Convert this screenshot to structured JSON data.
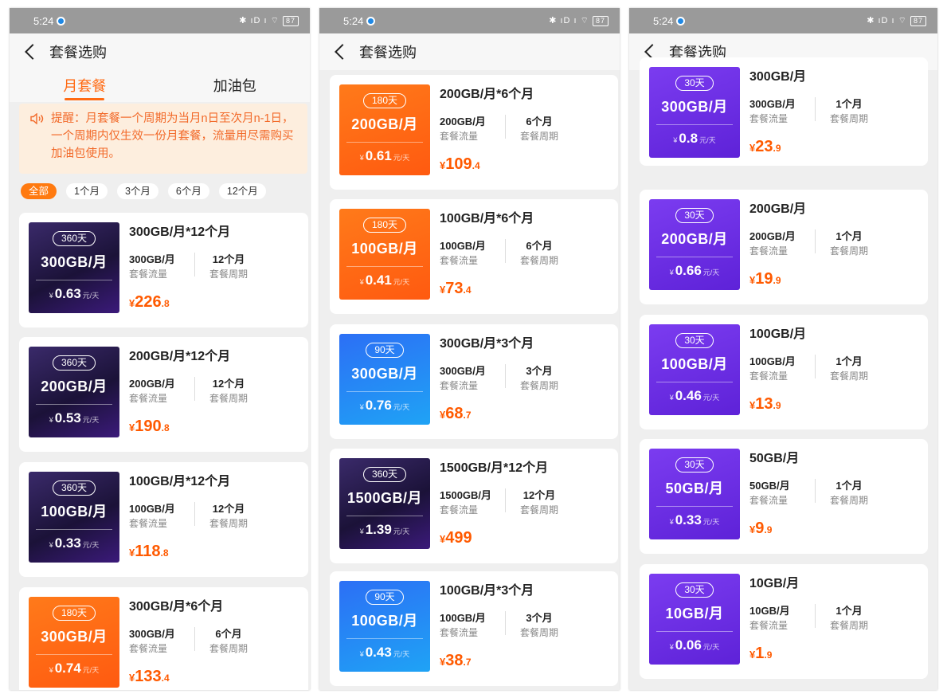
{
  "status": {
    "time": "5:24",
    "icons": "✱ ıD ı ⌔",
    "battery": "87"
  },
  "nav": {
    "title": "套餐选购"
  },
  "tabs": [
    {
      "label": "月套餐"
    },
    {
      "label": "加油包"
    }
  ],
  "notice": {
    "text": "提醒：月套餐一个周期为当月n日至次月n-1日，一个周期内仅生效一份月套餐，流量用尽需购买加油包使用。"
  },
  "filters": [
    "全部",
    "1个月",
    "3个月",
    "6个月",
    "12个月"
  ],
  "labels": {
    "flow": "套餐流量",
    "period": "套餐周期",
    "currency": "¥",
    "daily_unit": "元/天"
  },
  "panel1": [
    {
      "days": "360天",
      "cap": "300GB/月",
      "daily": "0.63",
      "name": "300GB/月*12个月",
      "flow": "300GB/月",
      "period": "12个月",
      "price_int": "226",
      "price_dec": ".8"
    },
    {
      "days": "360天",
      "cap": "200GB/月",
      "daily": "0.53",
      "name": "200GB/月*12个月",
      "flow": "200GB/月",
      "period": "12个月",
      "price_int": "190",
      "price_dec": ".8"
    },
    {
      "days": "360天",
      "cap": "100GB/月",
      "daily": "0.33",
      "name": "100GB/月*12个月",
      "flow": "100GB/月",
      "period": "12个月",
      "price_int": "118",
      "price_dec": ".8"
    },
    {
      "days": "180天",
      "cap": "300GB/月",
      "daily": "0.74",
      "name": "300GB/月*6个月",
      "flow": "300GB/月",
      "period": "6个月",
      "price_int": "133",
      "price_dec": ".4"
    }
  ],
  "panel2": [
    {
      "days": "180天",
      "cap": "200GB/月",
      "daily": "0.61",
      "name": "200GB/月*6个月",
      "flow": "200GB/月",
      "period": "6个月",
      "price_int": "109",
      "price_dec": ".4"
    },
    {
      "days": "180天",
      "cap": "100GB/月",
      "daily": "0.41",
      "name": "100GB/月*6个月",
      "flow": "100GB/月",
      "period": "6个月",
      "price_int": "73",
      "price_dec": ".4"
    },
    {
      "days": "90天",
      "cap": "300GB/月",
      "daily": "0.76",
      "name": "300GB/月*3个月",
      "flow": "300GB/月",
      "period": "3个月",
      "price_int": "68",
      "price_dec": ".7"
    },
    {
      "days": "360天",
      "cap": "1500GB/月",
      "daily": "1.39",
      "name": "1500GB/月*12个月",
      "flow": "1500GB/月",
      "period": "12个月",
      "price_int": "499",
      "price_dec": ""
    },
    {
      "days": "90天",
      "cap": "100GB/月",
      "daily": "0.43",
      "name": "100GB/月*3个月",
      "flow": "100GB/月",
      "period": "3个月",
      "price_int": "38",
      "price_dec": ".7"
    }
  ],
  "panel3": [
    {
      "days": "30天",
      "cap": "300GB/月",
      "daily": "0.8",
      "name": "300GB/月",
      "flow": "300GB/月",
      "period": "1个月",
      "price_int": "23",
      "price_dec": ".9"
    },
    {
      "days": "30天",
      "cap": "200GB/月",
      "daily": "0.66",
      "name": "200GB/月",
      "flow": "200GB/月",
      "period": "1个月",
      "price_int": "19",
      "price_dec": ".9"
    },
    {
      "days": "30天",
      "cap": "100GB/月",
      "daily": "0.46",
      "name": "100GB/月",
      "flow": "100GB/月",
      "period": "1个月",
      "price_int": "13",
      "price_dec": ".9"
    },
    {
      "days": "30天",
      "cap": "50GB/月",
      "daily": "0.33",
      "name": "50GB/月",
      "flow": "50GB/月",
      "period": "1个月",
      "price_int": "9",
      "price_dec": ".9"
    },
    {
      "days": "30天",
      "cap": "10GB/月",
      "daily": "0.06",
      "name": "10GB/月",
      "flow": "10GB/月",
      "period": "1个月",
      "price_int": "1",
      "price_dec": ".9"
    }
  ],
  "colors": {
    "accent": "#ff6a13",
    "price": "#ff5a00",
    "notice_bg": "#fdeede"
  }
}
